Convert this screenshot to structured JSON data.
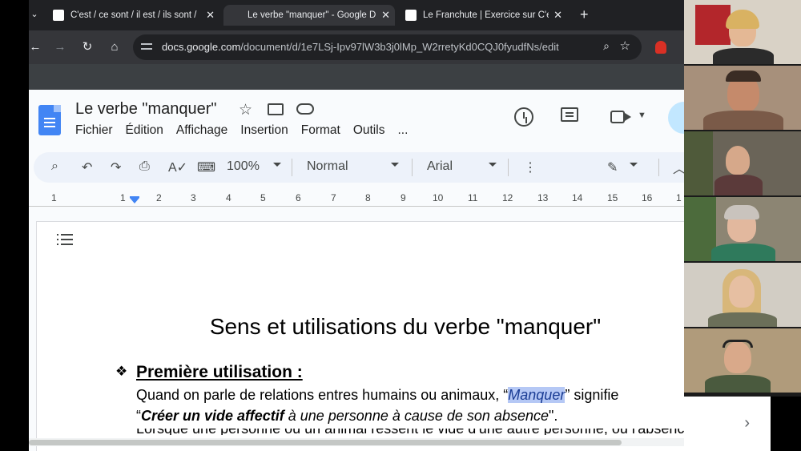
{
  "browser": {
    "tabs": [
      {
        "title": "C'est / ce sont / il est / ils sont /",
        "active": false,
        "favicon": "site-favicon"
      },
      {
        "title": "Le verbe \"manquer\" - Google D",
        "active": true,
        "favicon": "docs-favicon"
      },
      {
        "title": "Le Franchute | Exercice sur C'est",
        "active": false,
        "favicon": "site-favicon"
      }
    ],
    "url_domain": "docs.google.com",
    "url_path": "/document/d/1e7LSj-Ipv97lW3b3j0lMp_W2rretyKd0CQJ0fyudfNs/edit"
  },
  "docs": {
    "title": "Le verbe \"manquer\"",
    "menu": [
      "Fichier",
      "Édition",
      "Affichage",
      "Insertion",
      "Format",
      "Outils",
      "..."
    ],
    "toolbar": {
      "zoom": "100%",
      "style": "Normal",
      "font": "Arial"
    },
    "ruler_labels": [
      "1",
      "1",
      "2",
      "3",
      "4",
      "5",
      "6",
      "7",
      "8",
      "9",
      "10",
      "11",
      "12",
      "13",
      "14",
      "15",
      "16",
      "1"
    ]
  },
  "document": {
    "heading": "Sens et utilisations du verbe \"manquer\"",
    "bullet": "❖",
    "section_title": "Première utilisation :",
    "p1_before": "Quand on parle de relations entres humains ou animaux, “",
    "p1_highlight": "Manquer",
    "p1_after": "” signifie",
    "p2_open": "“",
    "p2_bold": "Créer un vide affectif",
    "p2_italic": " à une personne à cause de son absence",
    "p2_close": "\".",
    "p3_partial": "Lorsque une personne ou un animal ressent le vide d'une autre personne, ou l'absence de l'habitude"
  },
  "colors": {
    "docs_accent": "#4285f4",
    "chrome_dark": "#202124",
    "toolbar_bg": "#edf2fa",
    "highlight": "#b5c8f5"
  }
}
